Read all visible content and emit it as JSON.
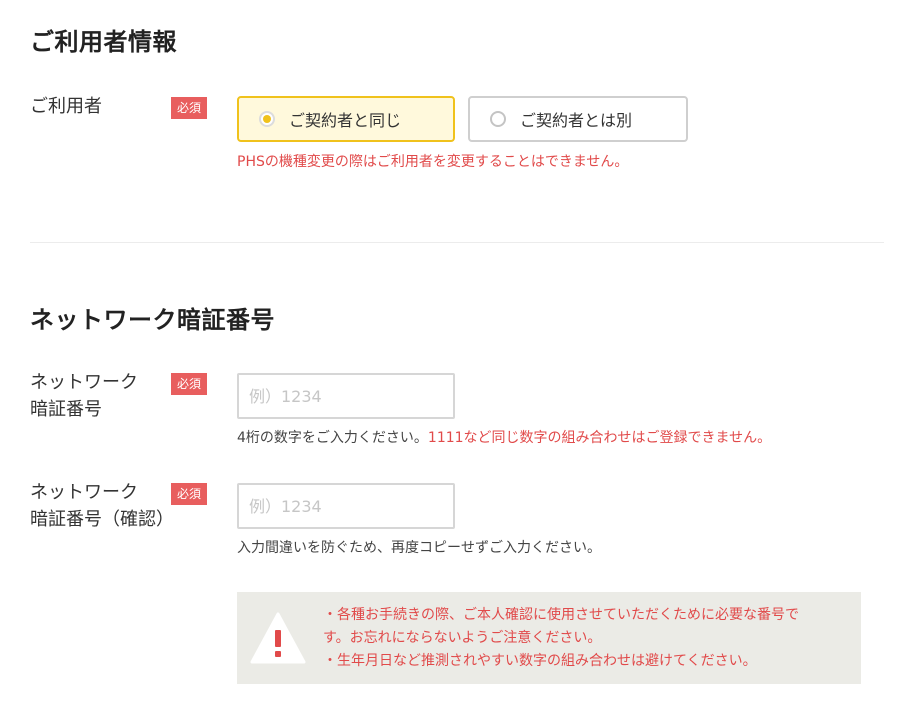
{
  "user_section": {
    "title": "ご利用者情報",
    "label": "ご利用者",
    "required": "必須",
    "options": [
      {
        "label": "ご契約者と同じ",
        "selected": true
      },
      {
        "label": "ご契約者とは別",
        "selected": false
      }
    ],
    "note": "PHSの機種変更の際はご利用者を変更することはできません。"
  },
  "pin_section": {
    "title": "ネットワーク暗証番号",
    "pin_field": {
      "label": "ネットワーク\n暗証番号",
      "required": "必須",
      "placeholder": "例）1234",
      "value": "",
      "help": "4桁の数字をご入力ください。",
      "help_warning": "1111など同じ数字の組み合わせはご登録できません。"
    },
    "confirm_field": {
      "label": "ネットワーク\n暗証番号（確認）",
      "required": "必須",
      "placeholder": "例）1234",
      "value": "",
      "help": "入力間違いを防ぐため、再度コピーせずご入力ください。"
    },
    "notice": {
      "icon": "warning-icon",
      "lines": [
        "・各種お手続きの際、ご本人確認に使用させていただくために必要な番号です。お忘れにならないようご注意ください。",
        "・生年月日など推測されやすい数字の組み合わせは避けてください。"
      ]
    }
  },
  "colors": {
    "accent": "#f0c21c",
    "selected_bg": "#fff9dc",
    "required_badge": "#e85e5e",
    "error_text": "#e14a4a",
    "notice_bg": "#ebebe6"
  }
}
